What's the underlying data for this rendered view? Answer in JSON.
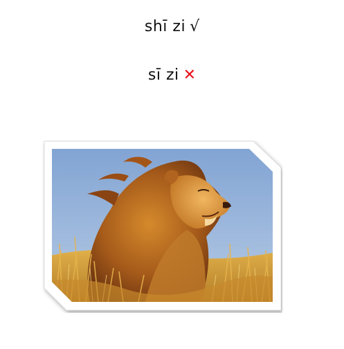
{
  "lines": [
    {
      "pinyin": "shī zi",
      "mark": "√",
      "mark_meaning": "correct",
      "mark_color": "#111111"
    },
    {
      "pinyin": "sī zi",
      "mark": "✕",
      "mark_meaning": "incorrect",
      "mark_color": "#e8111b"
    }
  ],
  "photo": {
    "subject": "lion-in-grass",
    "sky_color": "#8fb0d8",
    "mane_color": "#b5651d",
    "grass_color": "#d9a53a",
    "frame_color": "#ffffff"
  }
}
